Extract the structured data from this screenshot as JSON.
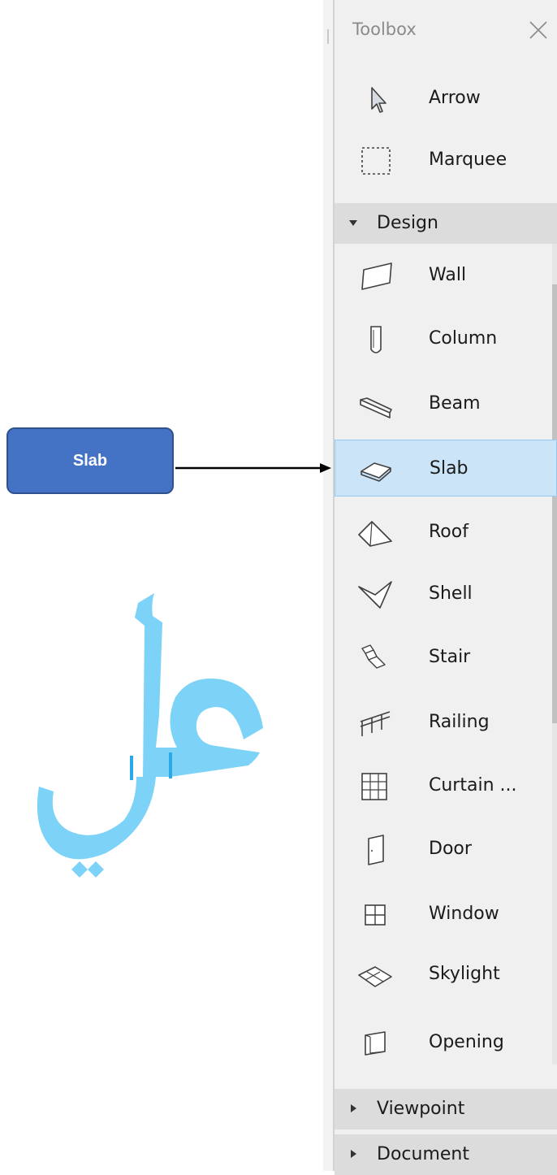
{
  "toolbox": {
    "title": "Toolbox",
    "close_icon": "close-icon",
    "tools_top": [
      {
        "label": "Arrow",
        "icon": "arrow-cursor-icon"
      },
      {
        "label": "Marquee",
        "icon": "marquee-icon"
      }
    ],
    "groups": {
      "design": "Design",
      "viewpoint": "Viewpoint",
      "document": "Document"
    },
    "design_tools": [
      {
        "label": "Wall",
        "icon": "wall-icon"
      },
      {
        "label": "Column",
        "icon": "column-icon"
      },
      {
        "label": "Beam",
        "icon": "beam-icon"
      },
      {
        "label": "Slab",
        "icon": "slab-icon",
        "selected": true
      },
      {
        "label": "Roof",
        "icon": "roof-icon"
      },
      {
        "label": "Shell",
        "icon": "shell-icon"
      },
      {
        "label": "Stair",
        "icon": "stair-icon"
      },
      {
        "label": "Railing",
        "icon": "railing-icon"
      },
      {
        "label": "Curtain ...",
        "icon": "curtain-wall-icon"
      },
      {
        "label": "Door",
        "icon": "door-icon"
      },
      {
        "label": "Window",
        "icon": "window-icon"
      },
      {
        "label": "Skylight",
        "icon": "skylight-icon"
      },
      {
        "label": "Opening",
        "icon": "opening-icon"
      }
    ]
  },
  "annotation": {
    "callout_label": "Slab",
    "callout_color": "#4472c4",
    "calligraphy_text": "علي",
    "calligraphy_color": "#7dd3f7"
  },
  "colors": {
    "selection_bg": "#cce4f7",
    "group_bg": "#dcdcdc",
    "panel_bg": "#f0f0f0"
  }
}
